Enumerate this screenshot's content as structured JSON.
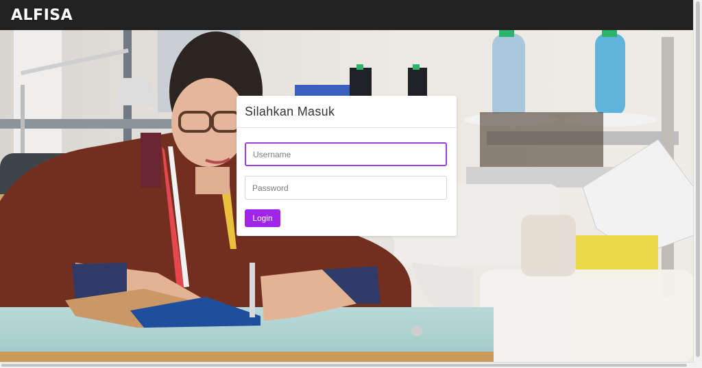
{
  "brand": {
    "name": "ALFISA"
  },
  "login": {
    "title": "Silahkan Masuk",
    "username_placeholder": "Username",
    "password_placeholder": "Password",
    "button_label": "Login"
  },
  "hero": {
    "subject": "tailor-sewing-workshop-photo"
  },
  "colors": {
    "navbar": "#212121",
    "accent": "#9f26e8",
    "focus_border": "#9b3fd8"
  }
}
